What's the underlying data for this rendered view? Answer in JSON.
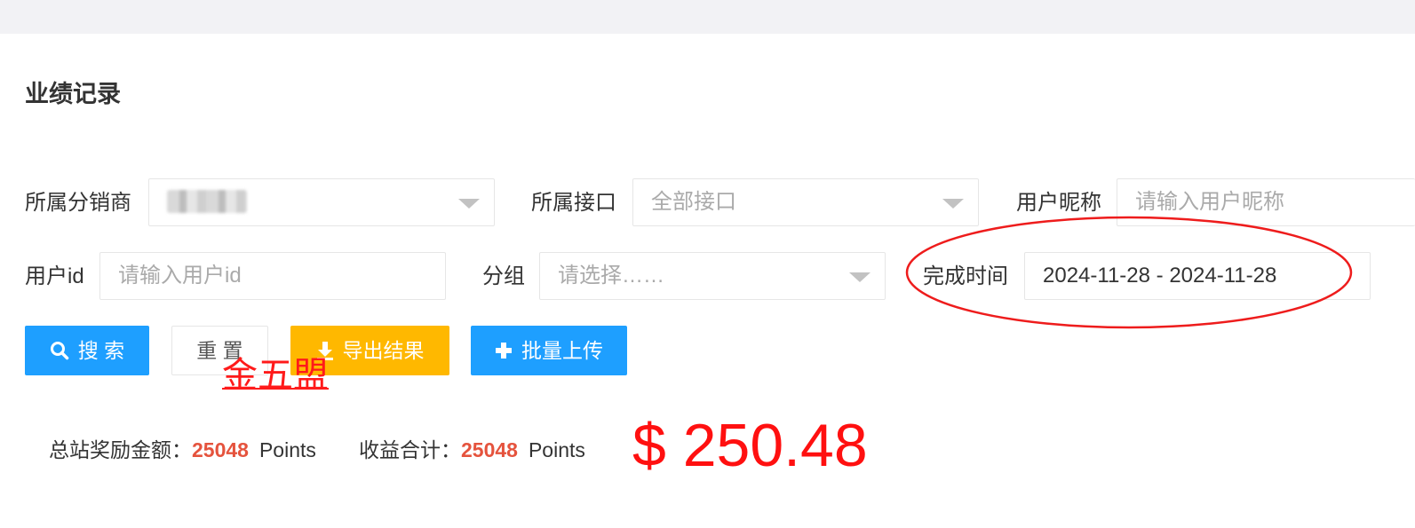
{
  "page": {
    "title": "业绩记录"
  },
  "filters": {
    "distributor": {
      "label": "所属分销商",
      "value": ""
    },
    "interface": {
      "label": "所属接口",
      "placeholder": "全部接口"
    },
    "nickname": {
      "label": "用户昵称",
      "placeholder": "请输入用户昵称"
    },
    "user_id": {
      "label": "用户id",
      "placeholder": "请输入用户id"
    },
    "group": {
      "label": "分组",
      "placeholder": "请选择……"
    },
    "finish_time": {
      "label": "完成时间",
      "value": "2024-11-28 - 2024-11-28"
    }
  },
  "buttons": {
    "search": "搜 索",
    "reset": "重 置",
    "export": "导出结果",
    "batch_upload": "批量上传"
  },
  "watermark": "金五盟",
  "stats": {
    "total_reward_label": "总站奖励金额：",
    "total_reward_value": "25048",
    "total_reward_unit": "Points",
    "income_total_label": "收益合计：",
    "income_total_value": "25048",
    "income_total_unit": "Points"
  },
  "big_amount": "$ 250.48",
  "colors": {
    "primary": "#1e9fff",
    "warning": "#ffb800",
    "highlight_number": "#e5533d",
    "annotation_red": "#ff1010"
  },
  "icons": {
    "search": "search-icon",
    "export": "download-icon",
    "upload": "plus-icon",
    "select": "caret-down-icon"
  }
}
